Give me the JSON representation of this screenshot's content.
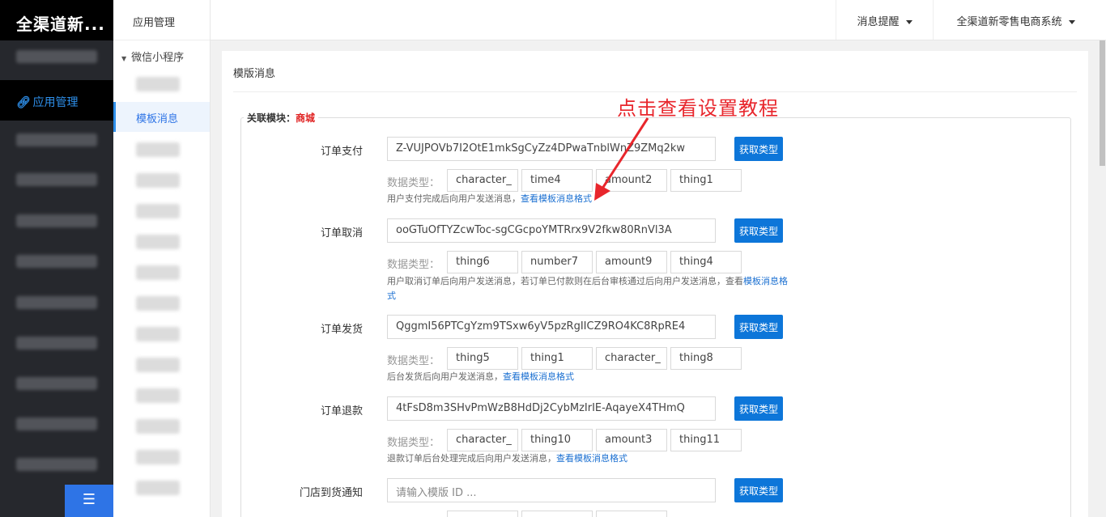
{
  "sidebar": {
    "logo": "全渠道新...",
    "active_item": "应用管理",
    "active_icon": "link-icon",
    "bottom_icon": "collapse-menu-icon"
  },
  "subnav": {
    "header": "应用管理",
    "group": "微信小程序",
    "active_item": "模板消息"
  },
  "topbar": {
    "notifications": "消息提醒",
    "system": "全渠道新零售电商系统"
  },
  "card": {
    "title": "模版消息",
    "module_label": "关联模块：",
    "module_value": "商城",
    "button_label": "获取类型",
    "dtype_label": "数据类型：",
    "link_text": "查看模板消息格式",
    "rows": [
      {
        "label": "订单支付",
        "value": "Z-VUJPOVb7I2OtE1mkSgCyZz4DPwaTnblWnZ9ZMq2kw",
        "types": [
          "character_",
          "time4",
          "amount2",
          "thing1"
        ],
        "hint": "用户支付完成后向用户发送消息，"
      },
      {
        "label": "订单取消",
        "value": "ooGTuOfTYZcwToc-sgCGcpoYMTRrx9V2fkw80RnVl3A",
        "types": [
          "thing6",
          "number7",
          "amount9",
          "thing4"
        ],
        "hint": "用户取消订单后向用户发送消息，若订单已付款则在后台审核通过后向用户发送消息，查看",
        "hint_line2": "模板消息格式"
      },
      {
        "label": "订单发货",
        "value": "QggmI56PTCgYzm9TSxw6yV5pzRgIICZ9RO4KC8RpRE4",
        "types": [
          "thing5",
          "thing1",
          "character_",
          "thing8"
        ],
        "hint": "后台发货后向用户发送消息，"
      },
      {
        "label": "订单退款",
        "value": "4tFsD8m3SHvPmWzB8HdDj2CybMzIrIE-AqayeX4THmQ",
        "types": [
          "character_",
          "thing10",
          "amount3",
          "thing11"
        ],
        "hint": "退款订单后台处理完成后向用户发送消息，"
      },
      {
        "label": "门店到货通知",
        "placeholder": "请输入模版 ID ..."
      }
    ]
  },
  "annotation": {
    "text": "点击查看设置教程",
    "color": "#e8262c"
  },
  "colors": {
    "accent": "#0d76d9",
    "sidebar_bg": "#26282d"
  }
}
